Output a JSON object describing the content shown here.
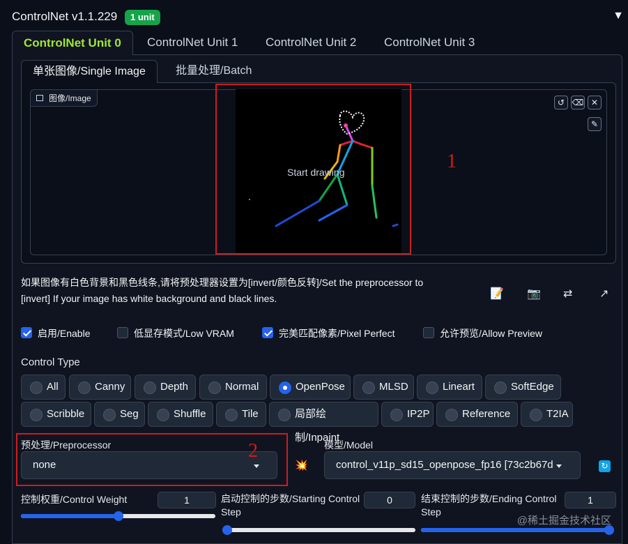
{
  "header": {
    "title": "ControlNet v1.1.229",
    "badge": "1 unit",
    "collapse_icon": "triangle-down-icon"
  },
  "unit_tabs": [
    "ControlNet Unit 0",
    "ControlNet Unit 1",
    "ControlNet Unit 2",
    "ControlNet Unit 3"
  ],
  "mode_tabs": [
    "单张图像/Single Image",
    "批量处理/Batch"
  ],
  "image": {
    "label": "图像/Image",
    "overlay_text": "Start drawing"
  },
  "annotations": {
    "one": "1",
    "two": "2"
  },
  "notice": "如果图像有白色背景和黑色线条,请将预处理器设置为[invert/颜色反转]/Set the preprocessor to [invert] If your image has white background and black lines.",
  "checkboxes": [
    {
      "label": "启用/Enable",
      "checked": true
    },
    {
      "label": "低显存模式/Low VRAM",
      "checked": false
    },
    {
      "label": "完美匹配像素/Pixel Perfect",
      "checked": true
    },
    {
      "label": "允许预览/Allow Preview",
      "checked": false
    }
  ],
  "control_type": {
    "label": "Control Type",
    "options": [
      "All",
      "Canny",
      "Depth",
      "Normal",
      "OpenPose",
      "MLSD",
      "Lineart",
      "SoftEdge",
      "Scribble",
      "Seg",
      "Shuffle",
      "Tile",
      "局部绘制/Inpaint",
      "IP2P",
      "Reference",
      "T2IA"
    ],
    "selected": "OpenPose"
  },
  "preprocessor": {
    "label": "预处理/Preprocessor",
    "value": "none"
  },
  "model": {
    "label": "模型/Model",
    "value": "control_v11p_sd15_openpose_fp16 [73c2b67d"
  },
  "sliders": {
    "weight": {
      "label": "控制权重/Control Weight",
      "value": "1",
      "fraction": 0.5
    },
    "start": {
      "label": "启动控制的步数/Starting Control Step",
      "value": "0",
      "fraction": 0
    },
    "end": {
      "label": "结束控制的步数/Ending Control Step",
      "value": "1",
      "fraction": 1
    }
  },
  "watermark": "@稀土掘金技术社区",
  "colors": {
    "accent": "#2563eb",
    "tab_active": "#a3e635",
    "badge": "#16a34a",
    "annotation": "#d01c1c"
  }
}
